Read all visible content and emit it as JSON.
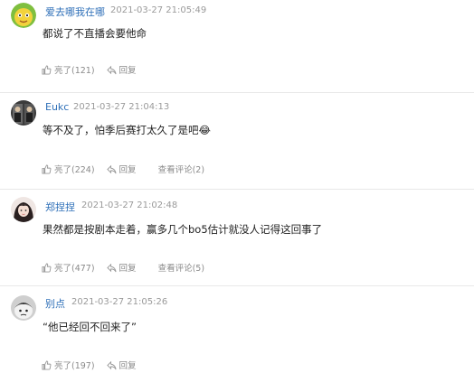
{
  "comments": [
    {
      "user": "爱去哪我在哪",
      "time": "2021-03-27 21:05:49",
      "text": "都说了不直播会要他命",
      "like_label": "亮了(121)",
      "reply_label": "回复",
      "view_replies_label": ""
    },
    {
      "user": "Eukc",
      "time": "2021-03-27 21:04:13",
      "text": "等不及了，怕季后赛打太久了是吧😂",
      "like_label": "亮了(224)",
      "reply_label": "回复",
      "view_replies_label": "查看评论(2)"
    },
    {
      "user": "郑捏捏",
      "time": "2021-03-27 21:02:48",
      "text": "果然都是按剧本走着，赢多几个bo5估计就没人记得这回事了",
      "like_label": "亮了(477)",
      "reply_label": "回复",
      "view_replies_label": "查看评论(5)"
    },
    {
      "user": "别点",
      "time": "2021-03-27 21:05:26",
      "text": "“他已经回不回来了”",
      "like_label": "亮了(197)",
      "reply_label": "回复",
      "view_replies_label": ""
    }
  ],
  "colors": {
    "username": "#2e6fb8",
    "meta": "#9a9a9a",
    "divider": "#e8e8e8"
  }
}
